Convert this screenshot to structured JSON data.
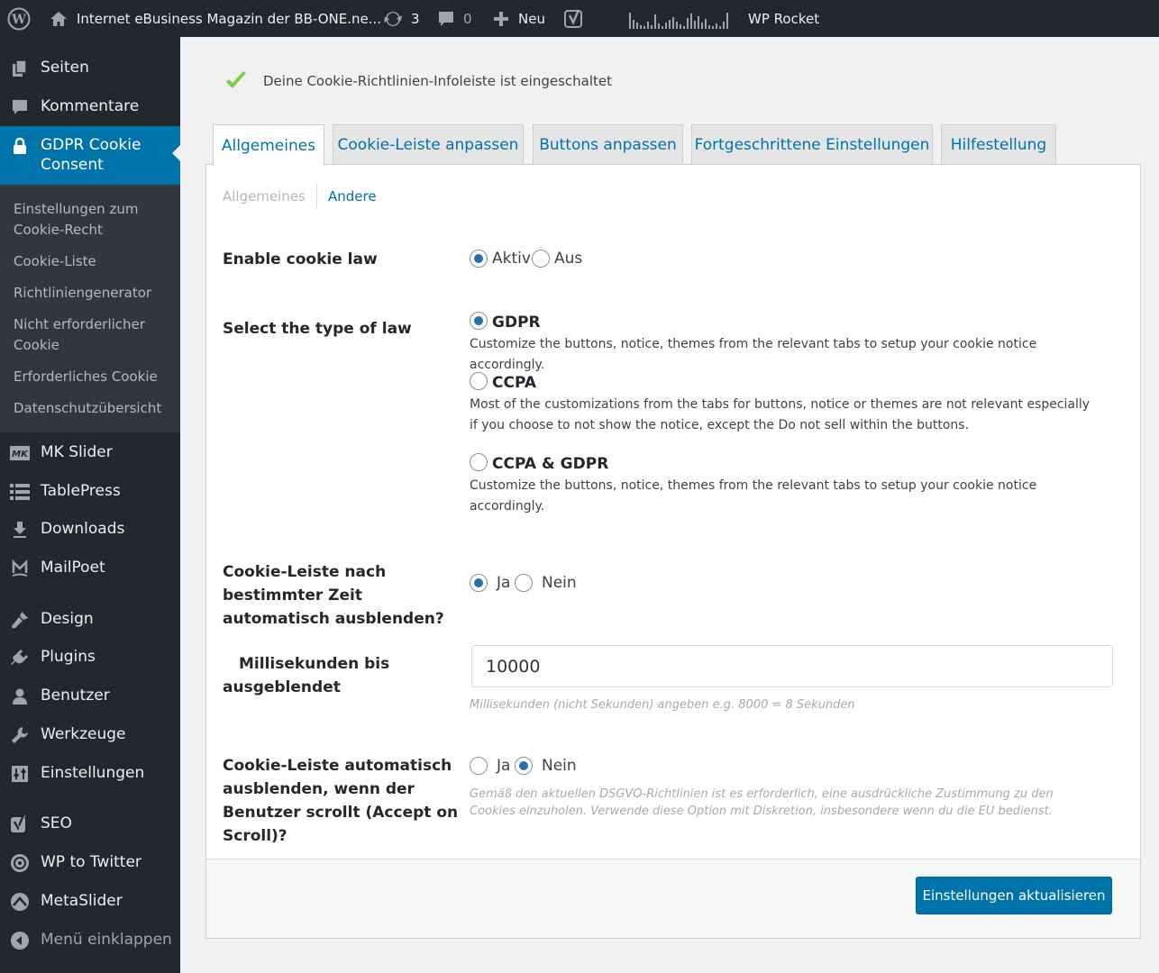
{
  "adminbar": {
    "site_name": "Internet eBusiness Magazin der BB-ONE.ne...",
    "updates_count": "3",
    "comments_count": "0",
    "new_label": "Neu",
    "wprocket_label": "WP Rocket",
    "icons": [
      "wordpress-icon",
      "home-icon",
      "updates-icon",
      "comments-icon",
      "plus-icon",
      "yoast-icon",
      "stats-sparkline-icon"
    ]
  },
  "sidebar": {
    "items": [
      {
        "label": "Seiten",
        "icon": "pages-icon"
      },
      {
        "label": "Kommentare",
        "icon": "comments-icon"
      },
      {
        "label": "GDPR Cookie Consent",
        "icon": "lock-icon"
      },
      {
        "label": "MK Slider",
        "icon": "mk-slider-icon"
      },
      {
        "label": "TablePress",
        "icon": "table-icon"
      },
      {
        "label": "Downloads",
        "icon": "download-icon"
      },
      {
        "label": "MailPoet",
        "icon": "mailpoet-icon"
      },
      {
        "label": "Design",
        "icon": "brush-icon"
      },
      {
        "label": "Plugins",
        "icon": "plugin-icon"
      },
      {
        "label": "Benutzer",
        "icon": "user-icon"
      },
      {
        "label": "Werkzeuge",
        "icon": "wrench-icon"
      },
      {
        "label": "Einstellungen",
        "icon": "settings-icon"
      },
      {
        "label": "SEO",
        "icon": "yoast-icon"
      },
      {
        "label": "WP to Twitter",
        "icon": "twitter-icon"
      },
      {
        "label": "MetaSlider",
        "icon": "metaslider-icon"
      },
      {
        "label": "Menü einklappen",
        "icon": "collapse-icon"
      }
    ],
    "submenu": [
      {
        "label": "Einstellungen zum Cookie-Recht"
      },
      {
        "label": "Cookie-Liste"
      },
      {
        "label": "Richtliniengenerator"
      },
      {
        "label": "Nicht erforderlicher Cookie"
      },
      {
        "label": "Erforderliches Cookie"
      },
      {
        "label": "Datenschutzübersicht"
      }
    ]
  },
  "notice": {
    "text": "Deine Cookie-Richtlinien-Infoleiste ist eingeschaltet"
  },
  "tabs": [
    {
      "label": "Allgemeines",
      "active": true
    },
    {
      "label": "Cookie-Leiste anpassen"
    },
    {
      "label": "Buttons anpassen"
    },
    {
      "label": "Fortgeschrittene Einstellungen"
    },
    {
      "label": "Hilfestellung"
    }
  ],
  "subnav": {
    "current": "Allgemeines",
    "other": "Andere"
  },
  "form": {
    "enable_law": {
      "label": "Enable cookie law",
      "on": "Aktiv",
      "off": "Aus",
      "value": "Aktiv"
    },
    "law_type": {
      "label": "Select the type of law",
      "value": "GDPR",
      "options": [
        {
          "label": "GDPR",
          "desc": "Customize the buttons, notice, themes from the relevant tabs to setup your cookie notice accordingly."
        },
        {
          "label": "CCPA",
          "desc": "Most of the customizations from the tabs for buttons, notice or themes are not relevant especially if you choose to not show the notice, except the Do not sell within the buttons."
        },
        {
          "label": "CCPA & GDPR",
          "desc": "Customize the buttons, notice, themes from the relevant tabs to setup your cookie notice accordingly."
        }
      ]
    },
    "auto_hide": {
      "label": "Cookie-Leiste nach bestimmter Zeit automatisch ausblenden?",
      "yes": "Ja",
      "no": "Nein",
      "value": "Ja"
    },
    "ms_until_hide": {
      "label": "Millisekunden bis ausgeblendet",
      "value": "10000",
      "help": "Millisekunden (nicht Sekunden) angeben e.g. 8000 = 8 Sekunden"
    },
    "accept_on_scroll": {
      "label": "Cookie-Leiste automatisch ausblenden, wenn der Benutzer scrollt (Accept on Scroll)?",
      "yes": "Ja",
      "no": "Nein",
      "value": "Nein",
      "help": "Gemäß den aktuellen DSGVO-Richtlinien ist es erforderlich, eine ausdrückliche Zustimmung zu den Cookies einzuholen. Verwende diese Option mit Diskretion, insbesondere wenn du die EU bedienst."
    }
  },
  "save_button": {
    "label": "Einstellungen aktualisieren"
  },
  "colors": {
    "accent": "#0073aa",
    "sidebar": "#23282d",
    "submenu": "#32373c",
    "check": "#7ad03a"
  }
}
